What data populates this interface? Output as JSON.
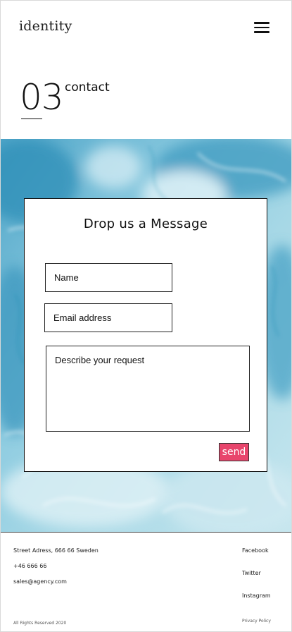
{
  "header": {
    "logo": "identity",
    "menu_icon": "hamburger-menu-icon"
  },
  "section": {
    "number": "03",
    "title": "contact"
  },
  "form": {
    "title": "Drop us a Message",
    "name_placeholder": "Name",
    "email_placeholder": "Email address",
    "request_placeholder": "Describe your request",
    "send_label": "send",
    "send_color": "#e8456c"
  },
  "footer": {
    "address": "Street Adress, 666 66 Sweden",
    "phone": "+46 666 66",
    "email": "sales@agency.com",
    "copyright": "All Rights Reserved 2020",
    "links": [
      "Facebook",
      "Twitter",
      "Instagram"
    ],
    "privacy": "Privacy Policy"
  }
}
